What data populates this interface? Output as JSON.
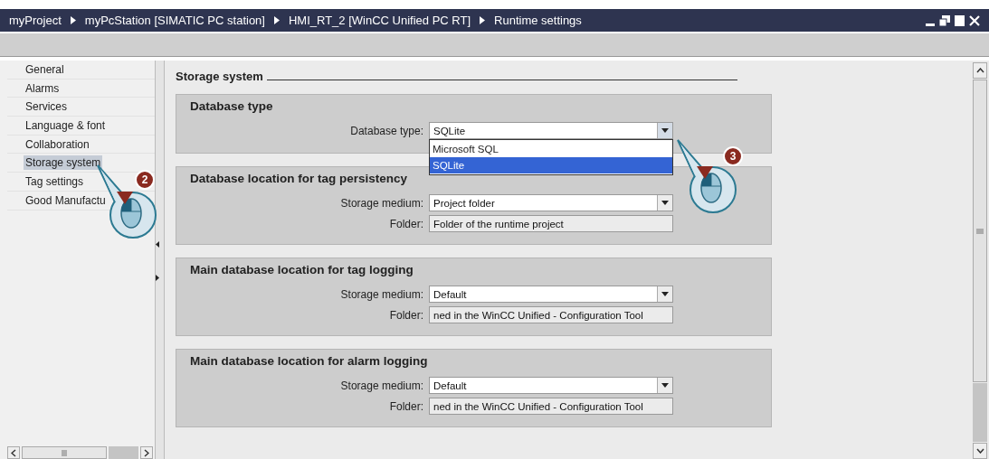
{
  "breadcrumb": [
    "myProject",
    "myPcStation [SIMATIC PC station]",
    "HMI_RT_2 [WinCC Unified PC RT]",
    "Runtime settings"
  ],
  "sidebar": {
    "items": [
      {
        "label": "General",
        "selected": false
      },
      {
        "label": "Alarms",
        "selected": false
      },
      {
        "label": "Services",
        "selected": false
      },
      {
        "label": "Language & font",
        "selected": false
      },
      {
        "label": "Collaboration",
        "selected": false
      },
      {
        "label": "Storage system",
        "selected": true
      },
      {
        "label": "Tag settings",
        "selected": false
      },
      {
        "label": "Good Manufactu",
        "selected": false
      }
    ]
  },
  "content": {
    "heading": "Storage system",
    "sections": [
      {
        "title": "Database type",
        "fields": [
          {
            "kind": "dropdown",
            "label": "Database type:",
            "value": "SQLite",
            "expanded": true,
            "options": [
              {
                "label": "Microsoft SQL",
                "selected": false
              },
              {
                "label": "SQLite",
                "selected": true
              }
            ]
          }
        ]
      },
      {
        "title": "Database location for tag persistency",
        "fields": [
          {
            "kind": "dropdown",
            "label": "Storage medium:",
            "value": "Project folder"
          },
          {
            "kind": "readonly",
            "label": "Folder:",
            "value": "Folder of the runtime project"
          }
        ]
      },
      {
        "title": "Main database location for tag logging",
        "fields": [
          {
            "kind": "dropdown",
            "label": "Storage medium:",
            "value": "Default"
          },
          {
            "kind": "readonly",
            "label": "Folder:",
            "value": "ned in the WinCC Unified - Configuration Tool"
          }
        ]
      },
      {
        "title": "Main database location for alarm logging",
        "fields": [
          {
            "kind": "dropdown",
            "label": "Storage medium:",
            "value": "Default"
          },
          {
            "kind": "readonly",
            "label": "Folder:",
            "value": "ned in the WinCC Unified - Configuration Tool"
          }
        ]
      }
    ]
  },
  "callouts": [
    {
      "number": "2"
    },
    {
      "number": "3"
    }
  ]
}
